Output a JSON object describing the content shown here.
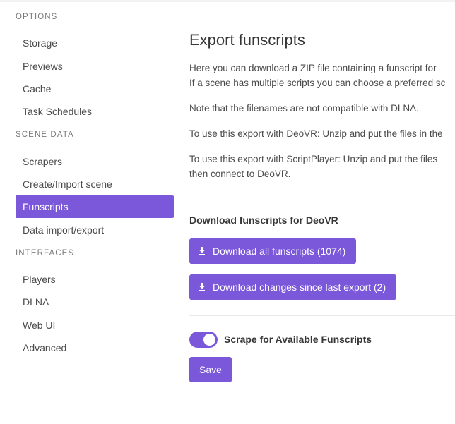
{
  "sidebar": {
    "sections": [
      {
        "label": "OPTIONS",
        "items": [
          "Storage",
          "Previews",
          "Cache",
          "Task Schedules"
        ]
      },
      {
        "label": "SCENE DATA",
        "items": [
          "Scrapers",
          "Create/Import scene",
          "Funscripts",
          "Data import/export"
        ]
      },
      {
        "label": "INTERFACES",
        "items": [
          "Players",
          "DLNA",
          "Web UI",
          "Advanced"
        ]
      }
    ],
    "active_item": "Funscripts"
  },
  "main": {
    "title": "Export funscripts",
    "paragraphs": [
      "Here you can download a ZIP file containing a funscript for",
      "If a scene has multiple scripts you can choose a preferred sc",
      "Note that the filenames are not compatible with DLNA.",
      "To use this export with DeoVR: Unzip and put the files in the",
      "To use this export with ScriptPlayer: Unzip and put the files",
      "then connect to DeoVR."
    ],
    "download_heading": "Download funscripts for DeoVR",
    "download_all_label": "Download all funscripts (1074)",
    "download_changes_label": "Download changes since last export (2)",
    "scrape_toggle_label": "Scrape for Available Funscripts",
    "scrape_toggle_on": true,
    "save_label": "Save"
  },
  "colors": {
    "accent": "#7b57d9",
    "text": "#363636",
    "muted": "#7a7a7a"
  }
}
